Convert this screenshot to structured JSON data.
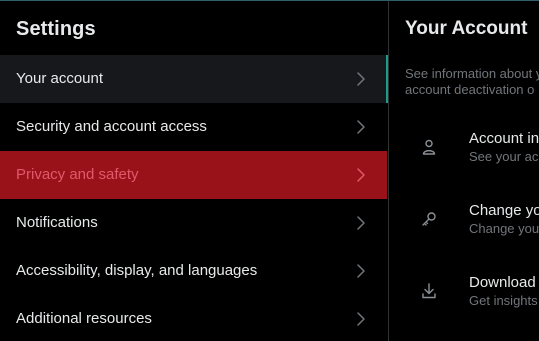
{
  "settings": {
    "title": "Settings",
    "items": [
      {
        "label": "Your account"
      },
      {
        "label": "Security and account access"
      },
      {
        "label": "Privacy and safety"
      },
      {
        "label": "Notifications"
      },
      {
        "label": "Accessibility, display, and languages"
      },
      {
        "label": "Additional resources"
      }
    ]
  },
  "account": {
    "title": "Your Account",
    "desc_line1": "See information about y",
    "desc_line2": "account deactivation o",
    "items": [
      {
        "title": "Account in",
        "sub": "See your acc",
        "icon": "person-icon"
      },
      {
        "title": "Change yo",
        "sub": "Change your",
        "icon": "key-icon"
      },
      {
        "title": "Download",
        "sub": "Get insights",
        "icon": "download-icon"
      }
    ]
  },
  "colors": {
    "background": "#000000",
    "active_row": "#16181c",
    "danger_row": "#9a1219",
    "danger_text": "#e0596b",
    "accent": "#1d9b8c",
    "muted_text": "#71767b"
  }
}
